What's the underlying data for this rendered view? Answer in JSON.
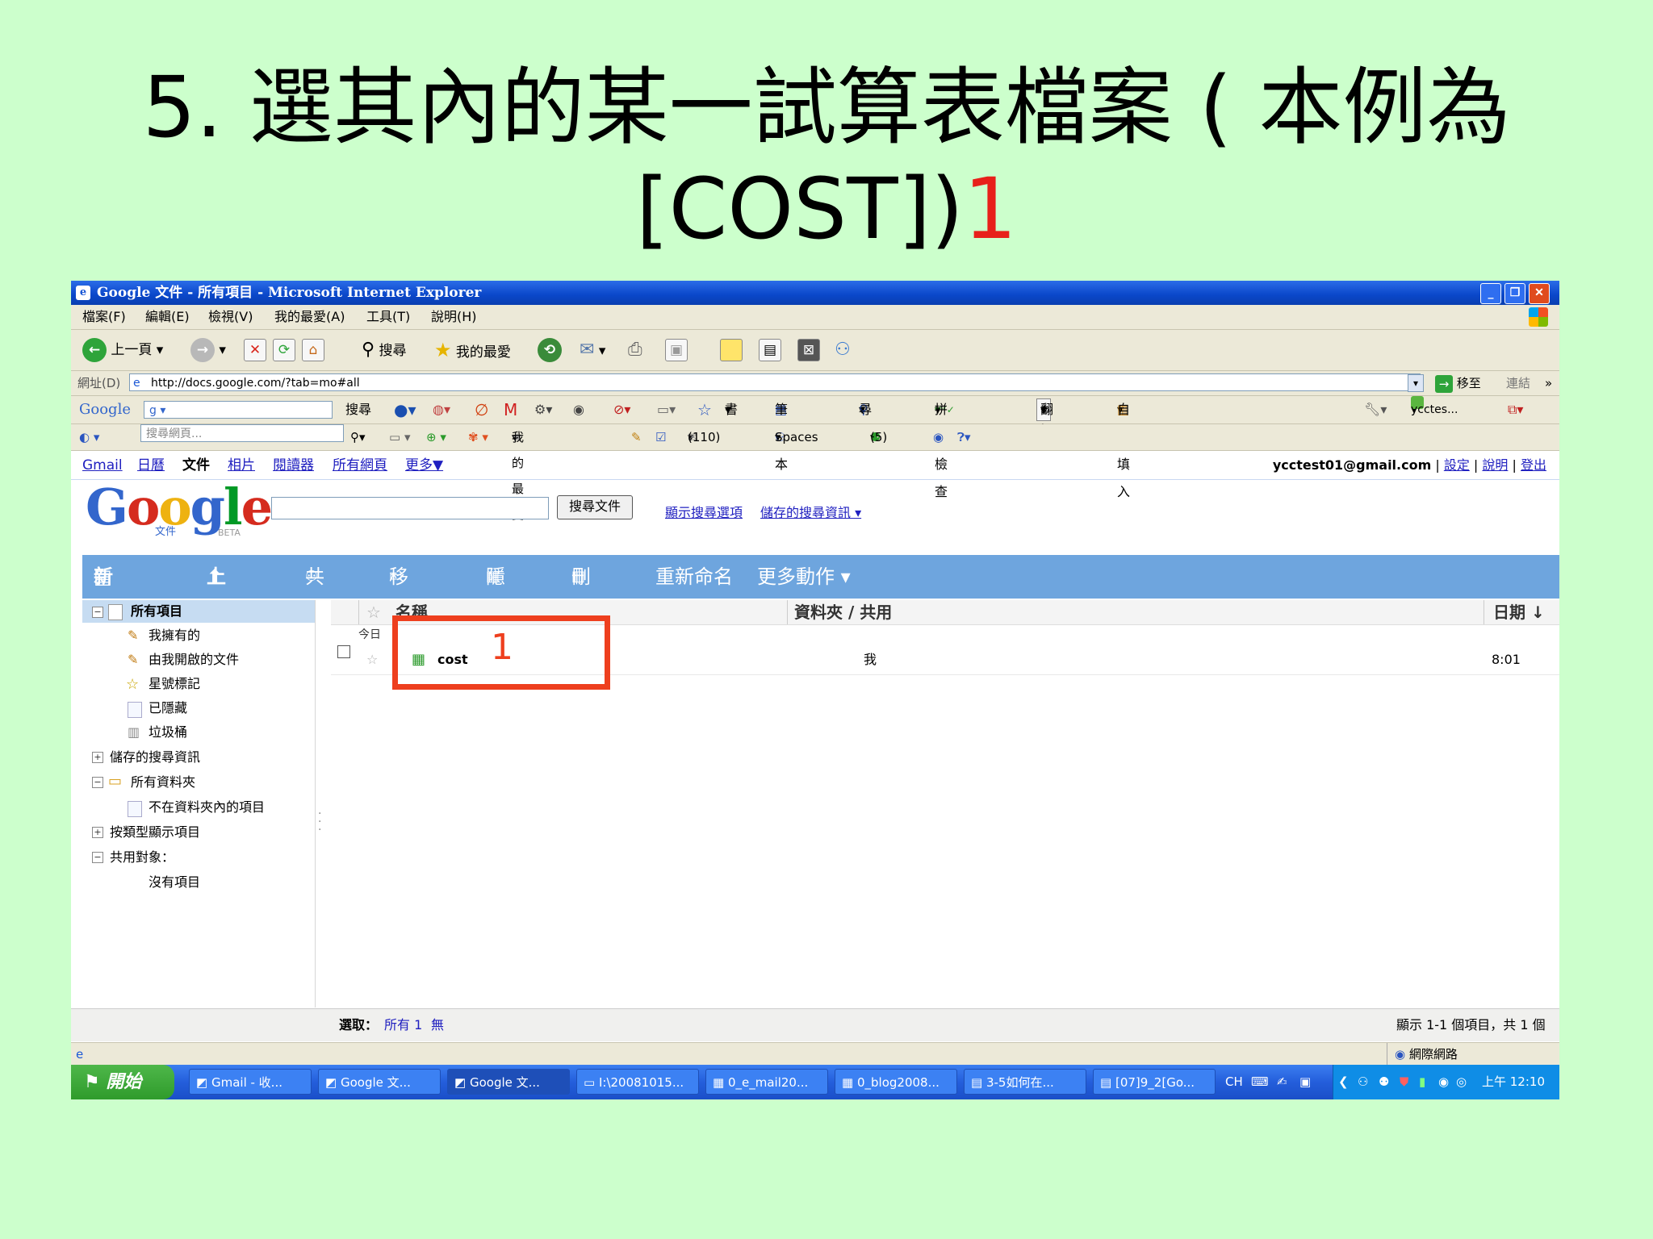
{
  "slide": {
    "title_line1": "5. 選其內的某一試算表檔案 ( 本例為",
    "title_line2": "[COST])",
    "title_marker": "1"
  },
  "window": {
    "title": "Google 文件 - 所有項目 - Microsoft Internet Explorer",
    "controls": {
      "minimize": "_",
      "restore": "❐",
      "close": "✕"
    }
  },
  "menubar": [
    "檔案(F)",
    "編輯(E)",
    "檢視(V)",
    "我的最愛(A)",
    "工具(T)",
    "說明(H)"
  ],
  "toolbar": {
    "back": "上一頁",
    "search": "搜尋",
    "favorites": "我的最愛"
  },
  "address": {
    "label": "網址(D)",
    "url": "http://docs.google.com/?tab=mo#all",
    "go": "移至",
    "links": "連結"
  },
  "google_toolbar": {
    "logo": "Google",
    "search": "搜尋",
    "bookmarks": "書籤",
    "notebook": "筆記本",
    "find": "尋找",
    "spellcheck": "拼字檢查",
    "translate": "翻譯",
    "autofill": "自動填入",
    "user": "ycctes..."
  },
  "toolbar2": {
    "placeholder": "搜尋網頁...",
    "favorites": "我的最愛",
    "mail_count": "(110)",
    "spaces": "Spaces",
    "count5": "(5)"
  },
  "nav": {
    "links": [
      "Gmail",
      "日曆",
      "文件",
      "相片",
      "閱讀器",
      "所有網頁",
      "更多▼"
    ],
    "current_index": 2,
    "account_email": "ycctest01@gmail.com",
    "settings": "設定",
    "help": "說明",
    "signout": "登出"
  },
  "docs": {
    "logo_sub": "文件",
    "logo_beta": "BETA",
    "search_button": "搜尋文件",
    "show_options": "顯示搜尋選項",
    "saved_searches": "儲存的搜尋資訊 ▾"
  },
  "actions": {
    "new": "新增 ▾",
    "upload": "上載",
    "share": "共用",
    "move": "移到 ▾",
    "hide": "隱藏",
    "delete": "刪除",
    "rename": "重新命名",
    "more": "更多動作 ▾"
  },
  "sidebar": {
    "all_items": "所有項目",
    "owned": "我擁有的",
    "opened": "由我開啟的文件",
    "starred": "星號標記",
    "hidden": "已隱藏",
    "trash": "垃圾桶",
    "saved_search": "儲存的搜尋資訊",
    "all_folders": "所有資料夾",
    "not_in_folder": "不在資料夾內的項目",
    "by_type": "按類型顯示項目",
    "shared_with": "共用對象：",
    "no_items": "沒有項目"
  },
  "list": {
    "col_name": "名稱",
    "col_folder": "資料夾 / 共用",
    "col_date": "日期 ↓",
    "group_today": "今日",
    "rows": [
      {
        "name": "cost",
        "folder": "我",
        "date": "8:01"
      }
    ]
  },
  "highlight": {
    "number": "1"
  },
  "status": {
    "select_label": "選取：",
    "select_all": "所有 1",
    "select_none": "無",
    "count": "顯示 1-1 個項目，共 1 個"
  },
  "iestatus": {
    "zone": "網際網路"
  },
  "taskbar": {
    "start": "開始",
    "tasks": [
      "Gmail - 收...",
      "Google 文...",
      "Google 文...",
      "I:\\20081015...",
      "0_e_mail20...",
      "0_blog2008...",
      "3-5如何在...",
      "[07]9_2[Go..."
    ],
    "active_index": 2,
    "lang": "CH",
    "clock": "上午 12:10"
  },
  "colors": {
    "slide_bg": "#ccffcc",
    "title_accent": "#e8201a",
    "actionbar": "#6ea5de",
    "highlight": "#ee3f1e"
  }
}
